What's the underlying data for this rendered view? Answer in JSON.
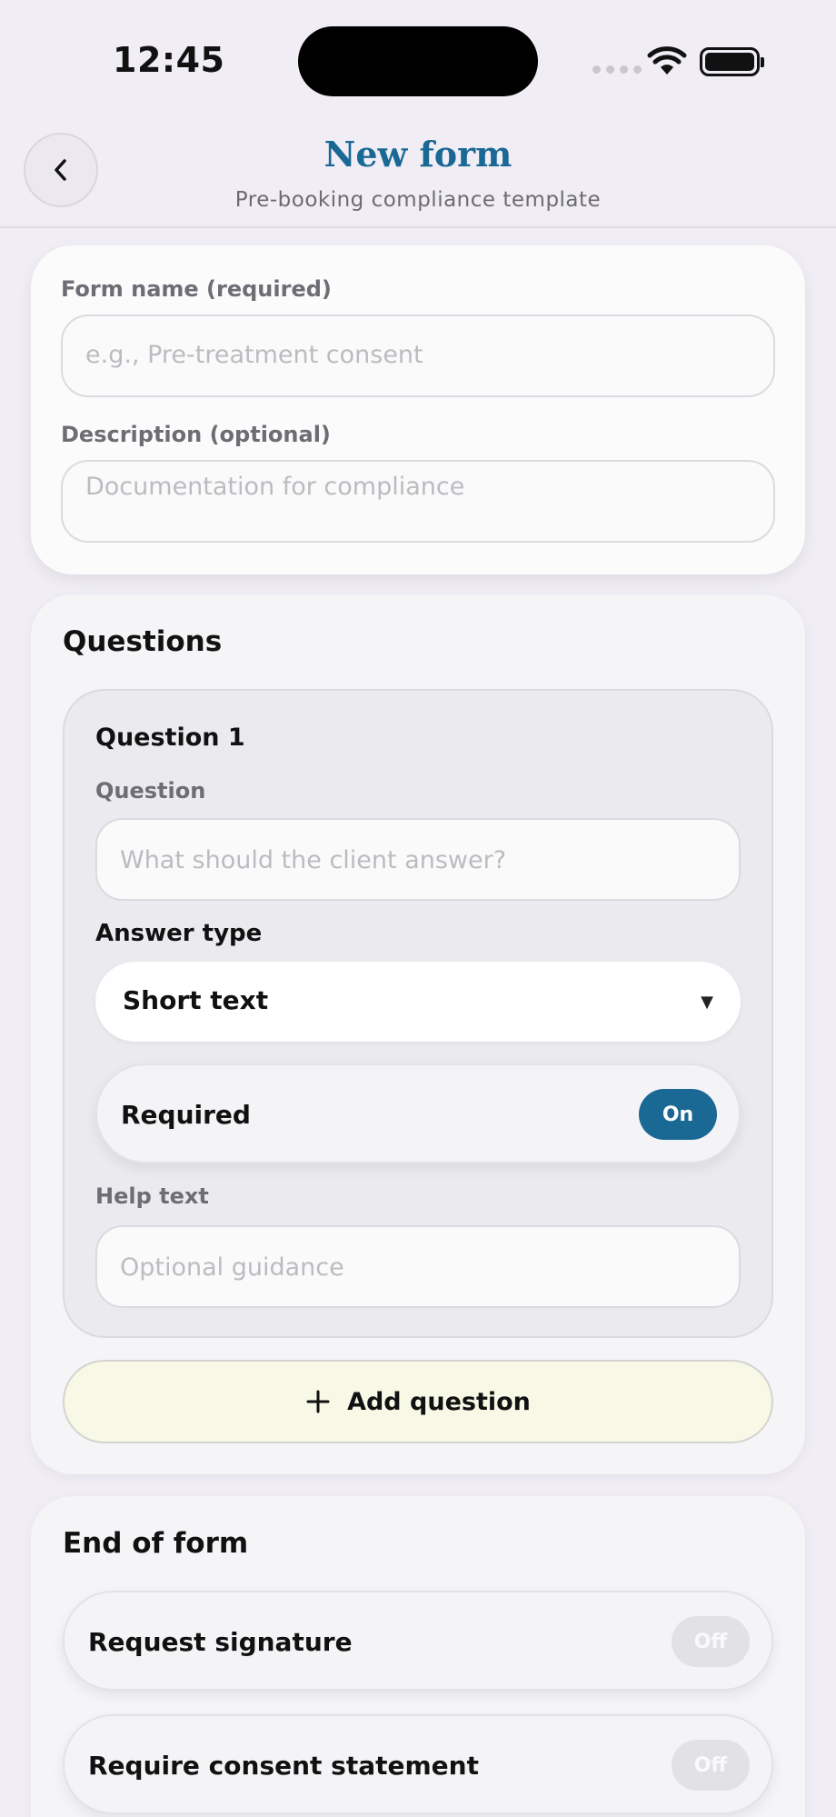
{
  "status_bar": {
    "time": "12:45"
  },
  "header": {
    "title": "New form",
    "subtitle": "Pre-booking compliance template"
  },
  "form": {
    "name_label": "Form name (required)",
    "name_placeholder": "e.g., Pre-treatment consent",
    "description_label": "Description (optional)",
    "description_placeholder": "Documentation for compliance"
  },
  "questions": {
    "title": "Questions",
    "items": [
      {
        "title": "Question 1",
        "question_label": "Question",
        "question_placeholder": "What should the client answer?",
        "answer_type_label": "Answer type",
        "answer_type_value": "Short text",
        "required_label": "Required",
        "required_state": "On",
        "help_label": "Help text",
        "help_placeholder": "Optional guidance"
      }
    ],
    "add_label": "Add question"
  },
  "end_of_form": {
    "title": "End of form",
    "toggles": [
      {
        "label": "Request signature",
        "state": "Off"
      },
      {
        "label": "Require consent statement",
        "state": "Off"
      }
    ]
  },
  "colors": {
    "accent": "#1a6894",
    "background": "#f0edf5",
    "add_button_bg": "#f7f9e6",
    "pill_off": "#e2e1e5"
  },
  "icons": {
    "back": "chevron-left-icon",
    "add": "plus-icon",
    "caret": "caret-down-icon",
    "wifi": "wifi-icon",
    "battery": "battery-icon",
    "signal": "cellular-signal-icon"
  }
}
